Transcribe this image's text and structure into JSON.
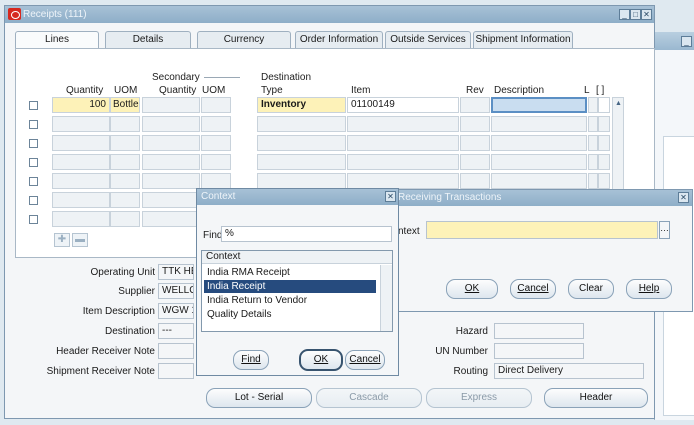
{
  "window": {
    "title": "Receipts (111)"
  },
  "tabs": [
    {
      "label": "Lines",
      "active": true
    },
    {
      "label": "Details"
    },
    {
      "label": "Currency"
    },
    {
      "label": "Order Information"
    },
    {
      "label": "Outside Services"
    },
    {
      "label": "Shipment Information"
    }
  ],
  "lines": {
    "headers": {
      "secondary": "Secondary",
      "quantity": "Quantity",
      "uom": "UOM",
      "sec_quantity": "Quantity",
      "sec_uom": "UOM",
      "destination": "Destination",
      "type": "Type",
      "item": "Item",
      "rev": "Rev",
      "description": "Description",
      "l": "L",
      "brackets": "[ ]"
    },
    "row1": {
      "quantity": "100",
      "uom": "Bottle",
      "type": "Inventory",
      "item": "01100149"
    }
  },
  "header_fields": {
    "operating_unit_label": "Operating Unit",
    "operating_unit_value": "TTK HE",
    "supplier_label": "Supplier",
    "supplier_value": "WELLC",
    "item_description_label": "Item Description",
    "item_description_value": "WGW 1",
    "destination_label": "Destination",
    "destination_value": "---",
    "header_note_label": "Header Receiver Note",
    "shipment_note_label": "Shipment Receiver Note",
    "hazard_label": "Hazard",
    "un_number_label": "UN Number",
    "routing_label": "Routing",
    "routing_value": "Direct Delivery"
  },
  "bottom_buttons": {
    "lot_serial": "Lot - Serial",
    "cascade": "Cascade",
    "express": "Express",
    "header": "Header"
  },
  "receiving_dialog": {
    "title": "Receiving Transactions",
    "context_label": "ntext",
    "ok": "OK",
    "cancel": "Cancel",
    "clear": "Clear",
    "help": "Help"
  },
  "context_dialog": {
    "title": "Context",
    "find_label": "Find",
    "find_value": "%",
    "list_header": "Context",
    "items": [
      "India RMA Receipt",
      "India Receipt",
      "India Return to Vendor",
      "Quality Details"
    ],
    "selected_index": 1,
    "find_button": "Find",
    "ok_button": "OK",
    "cancel_button": "Cancel"
  },
  "colors": {
    "titlebar": "#9ab8d0",
    "required_field": "#fdf2b8",
    "selection": "#264b7e"
  }
}
